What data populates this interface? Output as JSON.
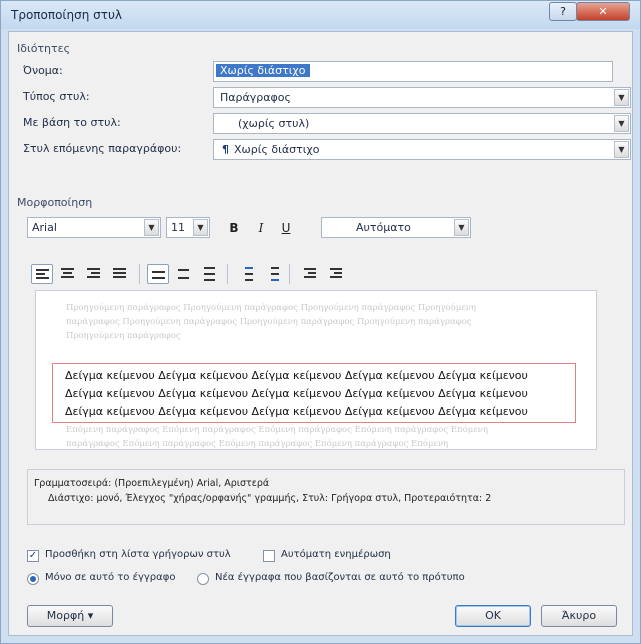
{
  "window": {
    "title": "Τροποποίηση στυλ",
    "help_label": "?",
    "close_label": "✕"
  },
  "properties": {
    "group_label": "Ιδιότητες",
    "name_label": "Όνομα:",
    "name_value": "Χωρίς διάστιχο",
    "style_type_label": "Τύπος στυλ:",
    "style_type_value": "Παράγραφος",
    "based_on_label": "Με βάση το στυλ:",
    "based_on_value": "(χωρίς στυλ)",
    "next_style_label": "Στυλ επόμενης παραγράφου:",
    "next_style_value": "Χωρίς διάστιχο"
  },
  "formatting": {
    "group_label": "Μορφοποίηση",
    "font": "Arial",
    "size": "11",
    "bold": "B",
    "italic": "I",
    "underline": "U",
    "color": "Αυτόματο"
  },
  "preview": {
    "prev_lines": [
      "Προηγούμενη παράγραφος Προηγούμενη παράγραφος Προηγούμενη παράγραφος Προηγούμενη",
      "παράγραφος Προηγούμενη παράγραφος Προηγούμενη παράγραφος Προηγούμενη παράγραφος",
      "Προηγούμενη παράγραφος"
    ],
    "sample_lines": [
      "Δείγμα κείμενου Δείγμα κείμενου Δείγμα κείμενου Δείγμα κείμενου Δείγμα κείμενου",
      "Δείγμα κείμενου Δείγμα κείμενου Δείγμα κείμενου Δείγμα κείμενου Δείγμα κείμενου",
      "Δείγμα κείμενου Δείγμα κείμενου Δείγμα κείμενου Δείγμα κείμενου Δείγμα κείμενου"
    ],
    "next_lines": [
      "Επόμενη παράγραφος Επόμενη παράγραφος Επόμενη παράγραφος Επόμενη παράγραφος Επόμενη",
      "παράγραφος Επόμενη παράγραφος Επόμενη παράγραφος Επόμενη παράγραφος Επόμενη"
    ]
  },
  "description": {
    "line1": "Γραμματοσειρά: (Προεπιλεγμένη) Arial, Αριστερά",
    "line2": "Διάστιχο: μονό, Έλεγχος \"χήρας/ορφανής\" γραμμής, Στυλ: Γρήγορα στυλ, Προτεραιότητα: 2"
  },
  "options": {
    "add_to_quick": "Προσθήκη στη λίστα γρήγορων στυλ",
    "add_to_quick_checked": true,
    "auto_update": "Αυτόματη ενημέρωση",
    "auto_update_checked": false,
    "only_this_doc": "Μόνο σε αυτό το έγγραφο",
    "new_docs": "Νέα έγγραφα που βασίζονται σε αυτό το πρότυπο"
  },
  "buttons": {
    "format": "Μορφή ▾",
    "ok": "OK",
    "cancel": "Άκυρο"
  }
}
